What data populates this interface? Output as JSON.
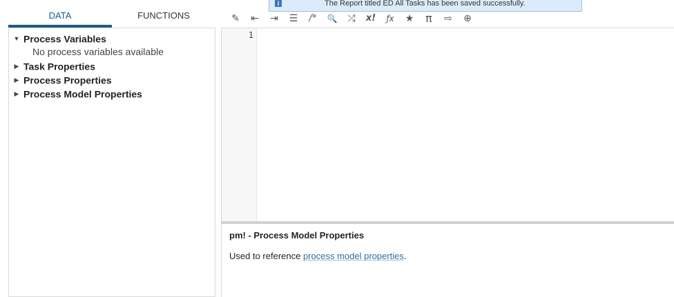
{
  "left_panel": {
    "tabs": [
      {
        "label": "DATA",
        "active": true
      },
      {
        "label": "FUNCTIONS",
        "active": false
      }
    ],
    "tree": [
      {
        "label": "Process Variables",
        "expanded": true,
        "arrow": "▼"
      },
      {
        "label": "Task Properties",
        "expanded": false,
        "arrow": "▶"
      },
      {
        "label": "Process Properties",
        "expanded": false,
        "arrow": "▶"
      },
      {
        "label": "Process Model Properties",
        "expanded": false,
        "arrow": "▶"
      }
    ],
    "empty_message": "No process variables available"
  },
  "notification": {
    "icon": "info-icon",
    "icon_glyph": "i",
    "message": "The Report titled ED All Tasks has been saved successfully."
  },
  "toolbar": {
    "icons": [
      {
        "name": "magic-wand-icon",
        "glyph": "✎"
      },
      {
        "name": "outdent-icon",
        "glyph": "⇤"
      },
      {
        "name": "indent-icon",
        "glyph": "⇥"
      },
      {
        "name": "list-icon",
        "glyph": "☰"
      },
      {
        "name": "comment-icon",
        "glyph": "/*"
      },
      {
        "name": "search-icon",
        "glyph": "🔍"
      },
      {
        "name": "shuffle-icon",
        "glyph": "⤮"
      },
      {
        "name": "expression-icon",
        "glyph": "x!"
      },
      {
        "name": "function-icon",
        "glyph": "ƒx"
      },
      {
        "name": "star-icon",
        "glyph": "★"
      },
      {
        "name": "pi-icon",
        "glyph": "π"
      },
      {
        "name": "export-icon",
        "glyph": "⇨"
      },
      {
        "name": "globe-icon",
        "glyph": "⊕"
      }
    ]
  },
  "editor": {
    "line_numbers": [
      "1"
    ],
    "content": ""
  },
  "help": {
    "title": "pm! - Process Model Properties",
    "text_prefix": "Used to reference ",
    "link_text": "process model properties",
    "text_suffix": "."
  }
}
